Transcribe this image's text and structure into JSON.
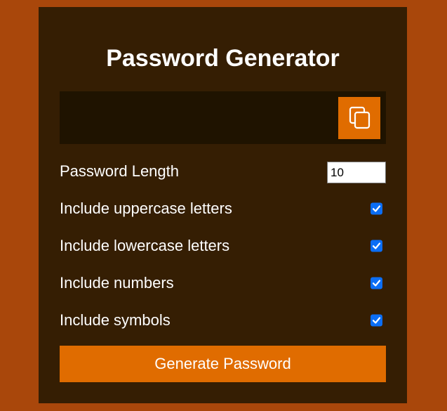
{
  "title": "Password Generator",
  "result": {
    "value": "",
    "copy_icon": "copy-icon"
  },
  "settings": {
    "length_label": "Password Length",
    "length_value": "10",
    "uppercase_label": "Include uppercase letters",
    "uppercase_checked": true,
    "lowercase_label": "Include lowercase letters",
    "lowercase_checked": true,
    "numbers_label": "Include numbers",
    "numbers_checked": true,
    "symbols_label": "Include symbols",
    "symbols_checked": true
  },
  "generate_label": "Generate Password",
  "colors": {
    "page_bg": "#a9470b",
    "card_bg": "#351e03",
    "result_bg": "#1f1300",
    "accent": "#e06c00",
    "checkbox": "#0b6ef5"
  }
}
